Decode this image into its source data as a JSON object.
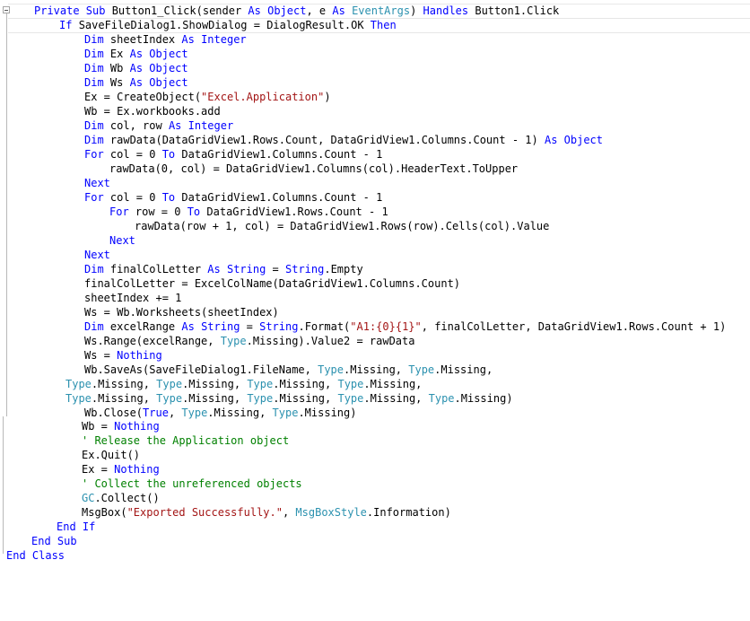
{
  "colors": {
    "keyword": "#0000ff",
    "type": "#2b91af",
    "string": "#a31515",
    "comment": "#008000",
    "plain": "#000000",
    "background": "#ffffff"
  },
  "icons": {
    "collapse": "collapse-minus-icon"
  },
  "code_lines": [
    {
      "tokens": [
        [
          "Private ",
          "kw"
        ],
        [
          "Sub ",
          "kw"
        ],
        [
          "Button1_Click(sender ",
          "plain"
        ],
        [
          "As ",
          "kw"
        ],
        [
          "Object",
          "kw"
        ],
        [
          ", e ",
          "plain"
        ],
        [
          "As ",
          "kw"
        ],
        [
          "EventArgs",
          "type"
        ],
        [
          ") ",
          "plain"
        ],
        [
          "Handles ",
          "kw"
        ],
        [
          "Button1.Click",
          "plain"
        ]
      ]
    },
    {
      "tokens": [
        [
          "If ",
          "kw"
        ],
        [
          "SaveFileDialog1.ShowDialog = DialogResult.OK ",
          "plain"
        ],
        [
          "Then",
          "kw"
        ]
      ]
    },
    {
      "tokens": [
        [
          "Dim ",
          "kw"
        ],
        [
          "sheetIndex ",
          "plain"
        ],
        [
          "As ",
          "kw"
        ],
        [
          "Integer",
          "kw"
        ]
      ]
    },
    {
      "tokens": [
        [
          "Dim ",
          "kw"
        ],
        [
          "Ex ",
          "plain"
        ],
        [
          "As ",
          "kw"
        ],
        [
          "Object",
          "kw"
        ]
      ]
    },
    {
      "tokens": [
        [
          "Dim ",
          "kw"
        ],
        [
          "Wb ",
          "plain"
        ],
        [
          "As ",
          "kw"
        ],
        [
          "Object",
          "kw"
        ]
      ]
    },
    {
      "tokens": [
        [
          "Dim ",
          "kw"
        ],
        [
          "Ws ",
          "plain"
        ],
        [
          "As ",
          "kw"
        ],
        [
          "Object",
          "kw"
        ]
      ]
    },
    {
      "tokens": [
        [
          "Ex = CreateObject(",
          "plain"
        ],
        [
          "\"Excel.Application\"",
          "str"
        ],
        [
          ")",
          "plain"
        ]
      ]
    },
    {
      "tokens": [
        [
          "Wb = Ex.workbooks.add",
          "plain"
        ]
      ]
    },
    {
      "tokens": [
        [
          "Dim ",
          "kw"
        ],
        [
          "col, row ",
          "plain"
        ],
        [
          "As ",
          "kw"
        ],
        [
          "Integer",
          "kw"
        ]
      ]
    },
    {
      "tokens": [
        [
          "Dim ",
          "kw"
        ],
        [
          "rawData(DataGridView1.Rows.Count, DataGridView1.Columns.Count - 1) ",
          "plain"
        ],
        [
          "As ",
          "kw"
        ],
        [
          "Object",
          "kw"
        ]
      ]
    },
    {
      "tokens": [
        [
          "For ",
          "kw"
        ],
        [
          "col = 0 ",
          "plain"
        ],
        [
          "To ",
          "kw"
        ],
        [
          "DataGridView1.Columns.Count - 1",
          "plain"
        ]
      ]
    },
    {
      "tokens": [
        [
          "rawData(0, col) = DataGridView1.Columns(col).HeaderText.ToUpper",
          "plain"
        ]
      ]
    },
    {
      "tokens": [
        [
          "Next",
          "kw"
        ]
      ]
    },
    {
      "tokens": [
        [
          "For ",
          "kw"
        ],
        [
          "col = 0 ",
          "plain"
        ],
        [
          "To ",
          "kw"
        ],
        [
          "DataGridView1.Columns.Count - 1",
          "plain"
        ]
      ]
    },
    {
      "tokens": [
        [
          "For ",
          "kw"
        ],
        [
          "row = 0 ",
          "plain"
        ],
        [
          "To ",
          "kw"
        ],
        [
          "DataGridView1.Rows.Count - 1",
          "plain"
        ]
      ]
    },
    {
      "tokens": [
        [
          "rawData(row + 1, col) = DataGridView1.Rows(row).Cells(col).Value",
          "plain"
        ]
      ]
    },
    {
      "tokens": [
        [
          "Next",
          "kw"
        ]
      ]
    },
    {
      "tokens": [
        [
          "Next",
          "kw"
        ]
      ]
    },
    {
      "tokens": [
        [
          "Dim ",
          "kw"
        ],
        [
          "finalColLetter ",
          "plain"
        ],
        [
          "As ",
          "kw"
        ],
        [
          "String ",
          "kw"
        ],
        [
          "= ",
          "plain"
        ],
        [
          "String",
          "kw"
        ],
        [
          ".Empty",
          "plain"
        ]
      ]
    },
    {
      "tokens": [
        [
          "finalColLetter = ExcelColName(DataGridView1.Columns.Count)",
          "plain"
        ]
      ]
    },
    {
      "tokens": [
        [
          "sheetIndex += 1",
          "plain"
        ]
      ]
    },
    {
      "tokens": [
        [
          "Ws = Wb.Worksheets(sheetIndex)",
          "plain"
        ]
      ]
    },
    {
      "tokens": [
        [
          "Dim ",
          "kw"
        ],
        [
          "excelRange ",
          "plain"
        ],
        [
          "As ",
          "kw"
        ],
        [
          "String ",
          "kw"
        ],
        [
          "= ",
          "plain"
        ],
        [
          "String",
          "kw"
        ],
        [
          ".Format(",
          "plain"
        ],
        [
          "\"A1:{0}{1}\"",
          "str"
        ],
        [
          ", finalColLetter, DataGridView1.Rows.Count + 1)",
          "plain"
        ]
      ]
    },
    {
      "tokens": [
        [
          "Ws.Range(excelRange, ",
          "plain"
        ],
        [
          "Type",
          "type"
        ],
        [
          ".Missing).Value2 = rawData",
          "plain"
        ]
      ]
    },
    {
      "tokens": [
        [
          "Ws = ",
          "plain"
        ],
        [
          "Nothing",
          "kw"
        ]
      ]
    },
    {
      "tokens": [
        [
          "Wb.SaveAs(SaveFileDialog1.FileName, ",
          "plain"
        ],
        [
          "Type",
          "type"
        ],
        [
          ".Missing, ",
          "plain"
        ],
        [
          "Type",
          "type"
        ],
        [
          ".Missing,",
          "plain"
        ]
      ]
    },
    {
      "tokens": [
        [
          "Type",
          "type"
        ],
        [
          ".Missing, ",
          "plain"
        ],
        [
          "Type",
          "type"
        ],
        [
          ".Missing, ",
          "plain"
        ],
        [
          "Type",
          "type"
        ],
        [
          ".Missing, ",
          "plain"
        ],
        [
          "Type",
          "type"
        ],
        [
          ".Missing,",
          "plain"
        ]
      ]
    },
    {
      "tokens": [
        [
          "Type",
          "type"
        ],
        [
          ".Missing, ",
          "plain"
        ],
        [
          "Type",
          "type"
        ],
        [
          ".Missing, ",
          "plain"
        ],
        [
          "Type",
          "type"
        ],
        [
          ".Missing, ",
          "plain"
        ],
        [
          "Type",
          "type"
        ],
        [
          ".Missing, ",
          "plain"
        ],
        [
          "Type",
          "type"
        ],
        [
          ".Missing)",
          "plain"
        ]
      ]
    },
    {
      "tokens": [
        [
          "Wb.Close(",
          "plain"
        ],
        [
          "True",
          "kw"
        ],
        [
          ", ",
          "plain"
        ],
        [
          "Type",
          "type"
        ],
        [
          ".Missing, ",
          "plain"
        ],
        [
          "Type",
          "type"
        ],
        [
          ".Missing)",
          "plain"
        ]
      ]
    },
    {
      "tokens": [
        [
          "Wb = ",
          "plain"
        ],
        [
          "Nothing",
          "kw"
        ]
      ]
    },
    {
      "tokens": [
        [
          "' Release the Application object",
          "cmt"
        ]
      ]
    },
    {
      "tokens": [
        [
          "Ex.Quit()",
          "plain"
        ]
      ]
    },
    {
      "tokens": [
        [
          "Ex = ",
          "plain"
        ],
        [
          "Nothing",
          "kw"
        ]
      ]
    },
    {
      "tokens": [
        [
          "' Collect the unreferenced objects",
          "cmt"
        ]
      ]
    },
    {
      "tokens": [
        [
          "GC",
          "type"
        ],
        [
          ".Collect()",
          "plain"
        ]
      ]
    },
    {
      "tokens": [
        [
          "MsgBox(",
          "plain"
        ],
        [
          "\"Exported Successfully.\"",
          "str"
        ],
        [
          ", ",
          "plain"
        ],
        [
          "MsgBoxStyle",
          "type"
        ],
        [
          ".Information)",
          "plain"
        ]
      ]
    },
    {
      "tokens": [
        [
          "End ",
          "kw"
        ],
        [
          "If",
          "kw"
        ]
      ]
    },
    {
      "tokens": [
        [
          "End ",
          "kw"
        ],
        [
          "Sub",
          "kw"
        ]
      ]
    },
    {
      "tokens": [
        [
          "End ",
          "kw"
        ],
        [
          "Class",
          "kw"
        ]
      ]
    }
  ]
}
